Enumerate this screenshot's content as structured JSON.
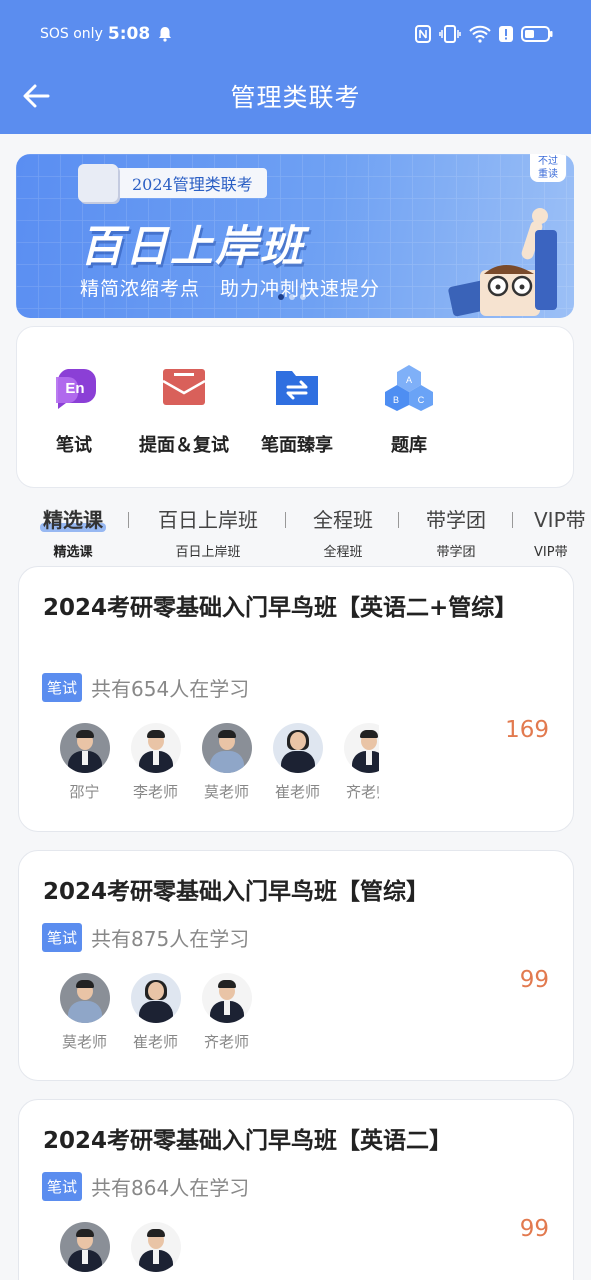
{
  "status_bar": {
    "carrier": "SOS only",
    "time": "5:08"
  },
  "nav": {
    "title": "管理类联考"
  },
  "banner": {
    "ribbon": "2024管理类联考",
    "title": "百日上岸班",
    "subtitle": "精简浓缩考点　助力冲刺快速提分",
    "corner_badge_line1": "不过",
    "corner_badge_line2": "重读"
  },
  "categories": [
    {
      "label": "笔试",
      "icon": "en-chat-icon"
    },
    {
      "label": "提面＆复试",
      "icon": "envelope-icon"
    },
    {
      "label": "笔面臻享",
      "icon": "folder-swap-icon"
    },
    {
      "label": "题库",
      "icon": "abc-cubes-icon"
    }
  ],
  "tabs": [
    {
      "label": "精选课",
      "sub": "精选课",
      "active": true
    },
    {
      "label": "百日上岸班",
      "sub": "百日上岸班"
    },
    {
      "label": "全程班",
      "sub": "全程班"
    },
    {
      "label": "带学团",
      "sub": "带学团"
    },
    {
      "label": "VIP带",
      "sub": "VIP带"
    }
  ],
  "courses": [
    {
      "title": "2024考研零基础入门早鸟班【英语二+管综】",
      "tag": "笔试",
      "learners": "共有654人在学习",
      "price": "169",
      "teachers": [
        "邵宁",
        "李老师",
        "莫老师",
        "崔老师",
        "齐老师"
      ]
    },
    {
      "title": "2024考研零基础入门早鸟班【管综】",
      "tag": "笔试",
      "learners": "共有875人在学习",
      "price": "99",
      "teachers": [
        "莫老师",
        "崔老师",
        "齐老师"
      ]
    },
    {
      "title": "2024考研零基础入门早鸟班【英语二】",
      "tag": "笔试",
      "learners": "共有864人在学习",
      "price": "99",
      "teachers": [
        "",
        ""
      ]
    }
  ],
  "colors": {
    "primary": "#5b8def",
    "price": "#e27a4f"
  }
}
